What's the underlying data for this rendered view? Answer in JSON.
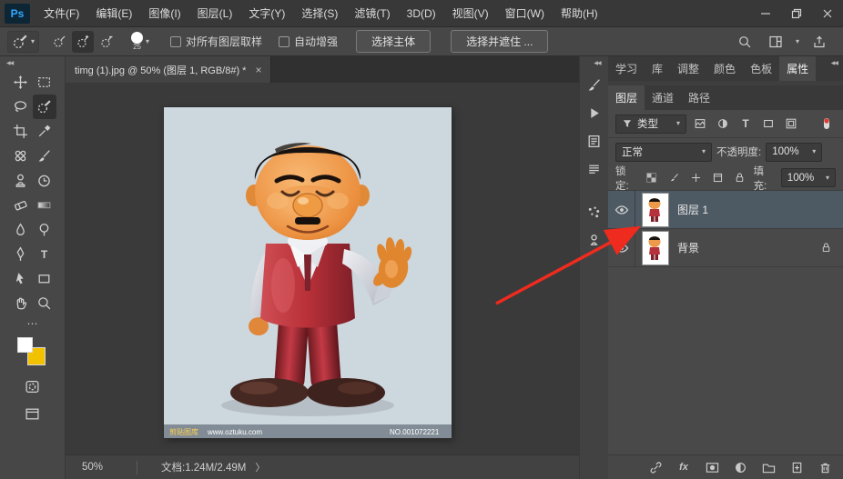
{
  "icons": {
    "caret": "▾",
    "collapse": "◀◀",
    "more": "⋯",
    "chevron_right": "〉",
    "type_glyph": "T",
    "fx_glyph": "fx",
    "close_glyph": "×"
  },
  "titlebar": {
    "logo": "Ps",
    "menus": [
      "文件(F)",
      "编辑(E)",
      "图像(I)",
      "图层(L)",
      "文字(Y)",
      "选择(S)",
      "滤镜(T)",
      "3D(D)",
      "视图(V)",
      "窗口(W)",
      "帮助(H)"
    ]
  },
  "options": {
    "brush_size": "25",
    "sample_all_layers": "对所有图层取样",
    "auto_enhance": "自动增强",
    "select_subject": "选择主体",
    "select_and_mask": "选择并遮住 ..."
  },
  "document": {
    "tab_title": "timg (1).jpg @ 50% (图层 1, RGB/8#) *",
    "watermark_brand": "剪贴图库",
    "watermark_url": "www.oztuku.com",
    "watermark_no": "NO.001072221"
  },
  "status": {
    "zoom": "50%",
    "doc_info": "文档:1.24M/2.49M"
  },
  "panels": {
    "top_tabs": [
      "学习",
      "库",
      "调整",
      "颜色",
      "色板",
      "属性"
    ],
    "layer_tabs": [
      "图层",
      "通道",
      "路径"
    ],
    "kind_label": "类型",
    "blend_mode": "正常",
    "opacity_label": "不透明度:",
    "opacity_value": "100%",
    "lock_label": "锁定:",
    "fill_label": "填充:",
    "fill_value": "100%",
    "layers": [
      {
        "name": "图层 1",
        "selected": true,
        "locked": false
      },
      {
        "name": "背景",
        "selected": false,
        "locked": true
      }
    ]
  }
}
